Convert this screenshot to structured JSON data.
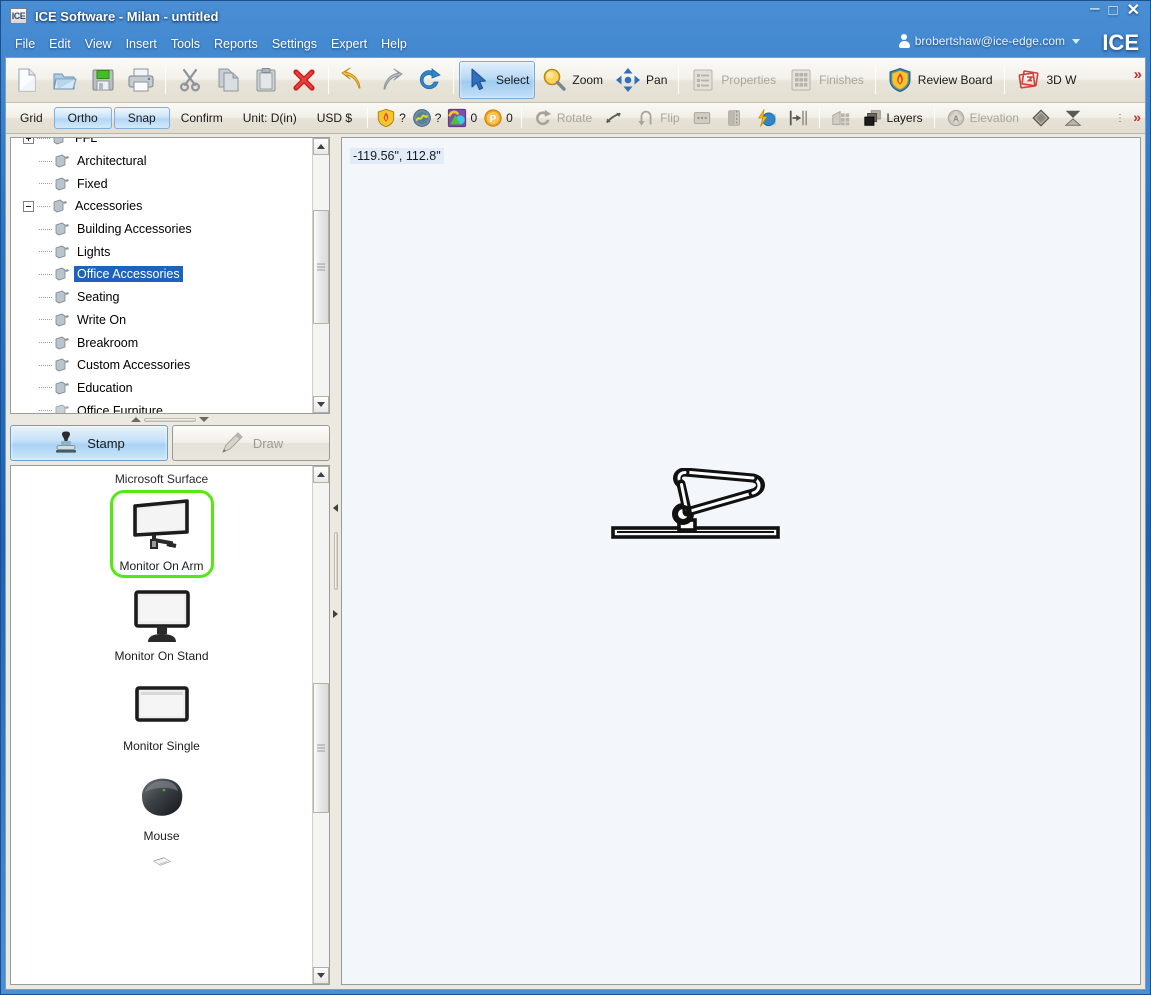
{
  "window": {
    "title": "ICE Software - Milan - untitled",
    "app_icon": "ICE",
    "minimize": "–",
    "maximize": "□",
    "close": "✕",
    "brand": "ICE"
  },
  "menu": {
    "items": [
      {
        "label": "File"
      },
      {
        "label": "Edit"
      },
      {
        "label": "View"
      },
      {
        "label": "Insert"
      },
      {
        "label": "Tools"
      },
      {
        "label": "Reports"
      },
      {
        "label": "Settings"
      },
      {
        "label": "Expert"
      },
      {
        "label": "Help"
      }
    ],
    "account": "brobertshaw@ice-edge.com"
  },
  "toolbar_main": {
    "overflow": "»",
    "buttons": [
      {
        "name": "new-file",
        "label": "",
        "icon": "new-document-icon",
        "state": "enabled"
      },
      {
        "name": "open-file",
        "label": "",
        "icon": "open-folder-icon",
        "state": "enabled"
      },
      {
        "name": "save-file",
        "label": "",
        "icon": "save-disk-icon",
        "state": "enabled"
      },
      {
        "name": "print",
        "label": "",
        "icon": "printer-icon",
        "state": "enabled"
      },
      {
        "name": "cut",
        "label": "",
        "icon": "scissors-icon",
        "state": "enabled"
      },
      {
        "name": "copy",
        "label": "",
        "icon": "copy-icon",
        "state": "enabled"
      },
      {
        "name": "paste",
        "label": "",
        "icon": "clipboard-icon",
        "state": "enabled"
      },
      {
        "name": "delete",
        "label": "",
        "icon": "red-x-icon",
        "state": "enabled"
      },
      {
        "name": "undo",
        "label": "",
        "icon": "undo-arrow-icon",
        "state": "enabled"
      },
      {
        "name": "redo",
        "label": "",
        "icon": "redo-arrow-icon",
        "state": "enabled"
      },
      {
        "name": "refresh",
        "label": "",
        "icon": "refresh-icon",
        "state": "enabled"
      },
      {
        "name": "select",
        "label": "Select",
        "icon": "cursor-arrow-icon",
        "state": "active"
      },
      {
        "name": "zoom",
        "label": "Zoom",
        "icon": "magnifier-icon",
        "state": "enabled"
      },
      {
        "name": "pan",
        "label": "Pan",
        "icon": "pan-arrows-icon",
        "state": "enabled"
      },
      {
        "name": "properties",
        "label": "Properties",
        "icon": "list-properties-icon",
        "state": "disabled"
      },
      {
        "name": "finishes",
        "label": "Finishes",
        "icon": "grid-swatch-icon",
        "state": "disabled"
      },
      {
        "name": "review-board",
        "label": "Review Board",
        "icon": "shield-flame-icon",
        "state": "enabled"
      },
      {
        "name": "3d-walk",
        "label": "3D W",
        "icon": "3d-cube-icon",
        "state": "enabled"
      }
    ]
  },
  "toolbar_secondary": {
    "overflow": "»",
    "overflow_dots": "⋮",
    "grid_label": "Grid",
    "ortho_label": "Ortho",
    "snap_label": "Snap",
    "confirm_label": "Confirm",
    "unit_label": "Unit: D(in)",
    "currency_label": "USD $",
    "status": [
      {
        "name": "fire-rating-status",
        "icon": "shield-flame-icon",
        "value": "?"
      },
      {
        "name": "acoustics-status",
        "icon": "blue-disc-icon",
        "value": "?"
      },
      {
        "name": "finishes-count",
        "icon": "color-shapes-icon",
        "value": "0"
      },
      {
        "name": "power-count",
        "icon": "orange-p-icon",
        "value": "0"
      }
    ],
    "buttons": [
      {
        "name": "rotate",
        "label": "Rotate",
        "icon": "rotate-icon",
        "state": "disabled"
      },
      {
        "name": "align",
        "label": "",
        "icon": "align-arrow-icon",
        "state": "enabled"
      },
      {
        "name": "flip",
        "label": "Flip",
        "icon": "flip-arrow-icon",
        "state": "disabled"
      },
      {
        "name": "mirror-h",
        "label": "",
        "icon": "mirror-horizontal-icon",
        "state": "disabled"
      },
      {
        "name": "mirror-v",
        "label": "",
        "icon": "mirror-vertical-icon",
        "state": "disabled"
      },
      {
        "name": "power-tool",
        "label": "",
        "icon": "lightning-globe-icon",
        "state": "enabled"
      },
      {
        "name": "snap-center",
        "label": "",
        "icon": "snap-center-icon",
        "state": "enabled"
      },
      {
        "name": "grid-view",
        "label": "",
        "icon": "grid-blocks-icon",
        "state": "enabled"
      },
      {
        "name": "layers",
        "label": "Layers",
        "icon": "layers-stack-icon",
        "state": "enabled"
      },
      {
        "name": "elevation",
        "label": "Elevation",
        "icon": "elevation-icon",
        "state": "disabled"
      },
      {
        "name": "diamond-view",
        "label": "",
        "icon": "diamond-icon",
        "state": "enabled"
      },
      {
        "name": "section-view",
        "label": "",
        "icon": "hourglass-section-icon",
        "state": "enabled"
      }
    ]
  },
  "tree": {
    "items": [
      {
        "label": "FFL",
        "depth": 0,
        "expander": "plus",
        "selected": false,
        "clipped": true
      },
      {
        "label": "Architectural",
        "depth": 1,
        "expander": "none",
        "selected": false
      },
      {
        "label": "Fixed",
        "depth": 1,
        "expander": "none",
        "selected": false
      },
      {
        "label": "Accessories",
        "depth": 0,
        "expander": "minus",
        "selected": false
      },
      {
        "label": "Building Accessories",
        "depth": 1,
        "expander": "none",
        "selected": false
      },
      {
        "label": "Lights",
        "depth": 1,
        "expander": "none",
        "selected": false
      },
      {
        "label": "Office Accessories",
        "depth": 1,
        "expander": "none",
        "selected": true
      },
      {
        "label": "Seating",
        "depth": 1,
        "expander": "none",
        "selected": false
      },
      {
        "label": "Write On",
        "depth": 1,
        "expander": "none",
        "selected": false
      },
      {
        "label": "Breakroom",
        "depth": 1,
        "expander": "none",
        "selected": false
      },
      {
        "label": "Custom Accessories",
        "depth": 1,
        "expander": "none",
        "selected": false
      },
      {
        "label": "Education",
        "depth": 1,
        "expander": "none",
        "selected": false
      },
      {
        "label": "Office Furniture",
        "depth": 1,
        "expander": "none",
        "selected": false,
        "clipped": true
      }
    ]
  },
  "mode_tabs": {
    "stamp": {
      "label": "Stamp",
      "icon": "stamp-icon",
      "state": "active"
    },
    "draw": {
      "label": "Draw",
      "icon": "pencil-icon",
      "state": "disabled"
    }
  },
  "catalog": {
    "heading": "Microsoft Surface",
    "selected_color": "#55e813",
    "items": [
      {
        "label": "Monitor On Arm",
        "icon": "monitor-on-arm-thumb",
        "selected": true
      },
      {
        "label": "Monitor On Stand",
        "icon": "monitor-on-stand-thumb",
        "selected": false
      },
      {
        "label": "Monitor Single",
        "icon": "monitor-single-thumb",
        "selected": false
      },
      {
        "label": "Mouse",
        "icon": "mouse-thumb",
        "selected": false
      },
      {
        "label": "",
        "icon": "keyboard-thumb",
        "selected": false
      }
    ]
  },
  "canvas": {
    "coordinates": "-119.56\", 112.8\"",
    "background": "#f3f7fb",
    "placed_object": "monitor-on-arm-plan-symbol"
  }
}
